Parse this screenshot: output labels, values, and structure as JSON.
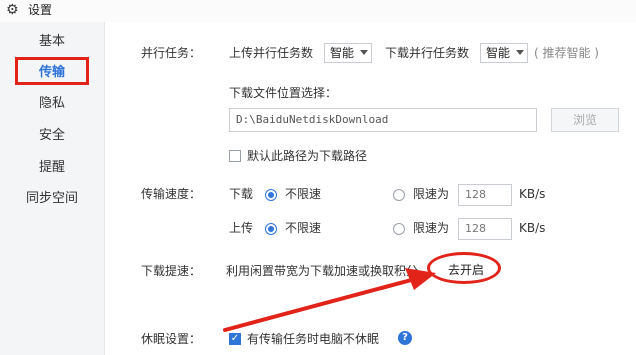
{
  "window": {
    "title": "设置",
    "icon": "gear-icon"
  },
  "sidebar": {
    "items": [
      {
        "label": "基本"
      },
      {
        "label": "传输",
        "active": true
      },
      {
        "label": "隐私"
      },
      {
        "label": "安全"
      },
      {
        "label": "提醒"
      },
      {
        "label": "同步空间"
      }
    ]
  },
  "parallel": {
    "label": "并行任务：",
    "upload_label": "上传并行任务数",
    "upload_value": "智能",
    "download_label": "下载并行任务数",
    "download_value": "智能",
    "hint": "( 推荐智能 )"
  },
  "download_location": {
    "label": "下载文件位置选择：",
    "path": "D:\\BaiduNetdiskDownload",
    "browse_label": "浏览",
    "default_checkbox_label": "默认此路径为下载路径",
    "default_checked": false
  },
  "speed": {
    "label": "传输速度：",
    "download": {
      "label": "下载",
      "unlimited_label": "不限速",
      "limit_label": "限速为",
      "limit_value": "128",
      "unit": "KB/s",
      "unlimited_selected": true
    },
    "upload": {
      "label": "上传",
      "unlimited_label": "不限速",
      "limit_label": "限速为",
      "limit_value": "128",
      "unit": "KB/s",
      "unlimited_selected": true
    }
  },
  "boost": {
    "label": "下载提速：",
    "description": "利用闲置带宽为下载加速或换取积分",
    "button_label": "去开启"
  },
  "sleep": {
    "label": "休眠设置：",
    "checkbox_label": "有传输任务时电脑不休眠",
    "checked": true,
    "help_icon": "help-icon"
  },
  "annotations": {
    "highlight_color": "#e2231a"
  },
  "colors": {
    "accent": "#2f74d9"
  }
}
